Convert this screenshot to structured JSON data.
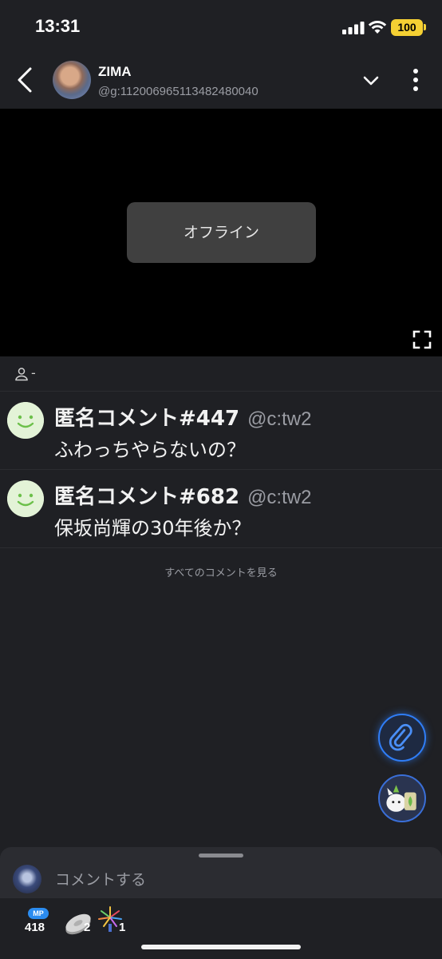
{
  "status_bar": {
    "time": "13:31",
    "battery": "100"
  },
  "header": {
    "channel_name": "ZIMA",
    "channel_id": "@g:112006965113482480040",
    "icons": [
      "back-arrow-icon",
      "chevron-down-icon",
      "more-vertical-icon"
    ]
  },
  "video": {
    "status_label": "オフライン",
    "icons": [
      "fullscreen-icon"
    ]
  },
  "viewers": {
    "count": "-"
  },
  "comments": [
    {
      "name": "匿名コメント#447",
      "handle": "@c:tw2",
      "text": "ふわっちやらないの？"
    },
    {
      "name": "匿名コメント#682",
      "handle": "@c:tw2",
      "text": "保坂尚輝の30年後か？"
    }
  ],
  "see_all_label": "すべてのコメントを見る",
  "comment_input": {
    "placeholder": "コメントする"
  },
  "actions": {
    "mp_badge": "MP",
    "mp_count": "418",
    "coin_count": "2",
    "firework_count": "1"
  },
  "colors": {
    "background": "#1f2024",
    "accent": "#2f7df6",
    "battery": "#f5d033",
    "smile": "#e3f3d7"
  }
}
